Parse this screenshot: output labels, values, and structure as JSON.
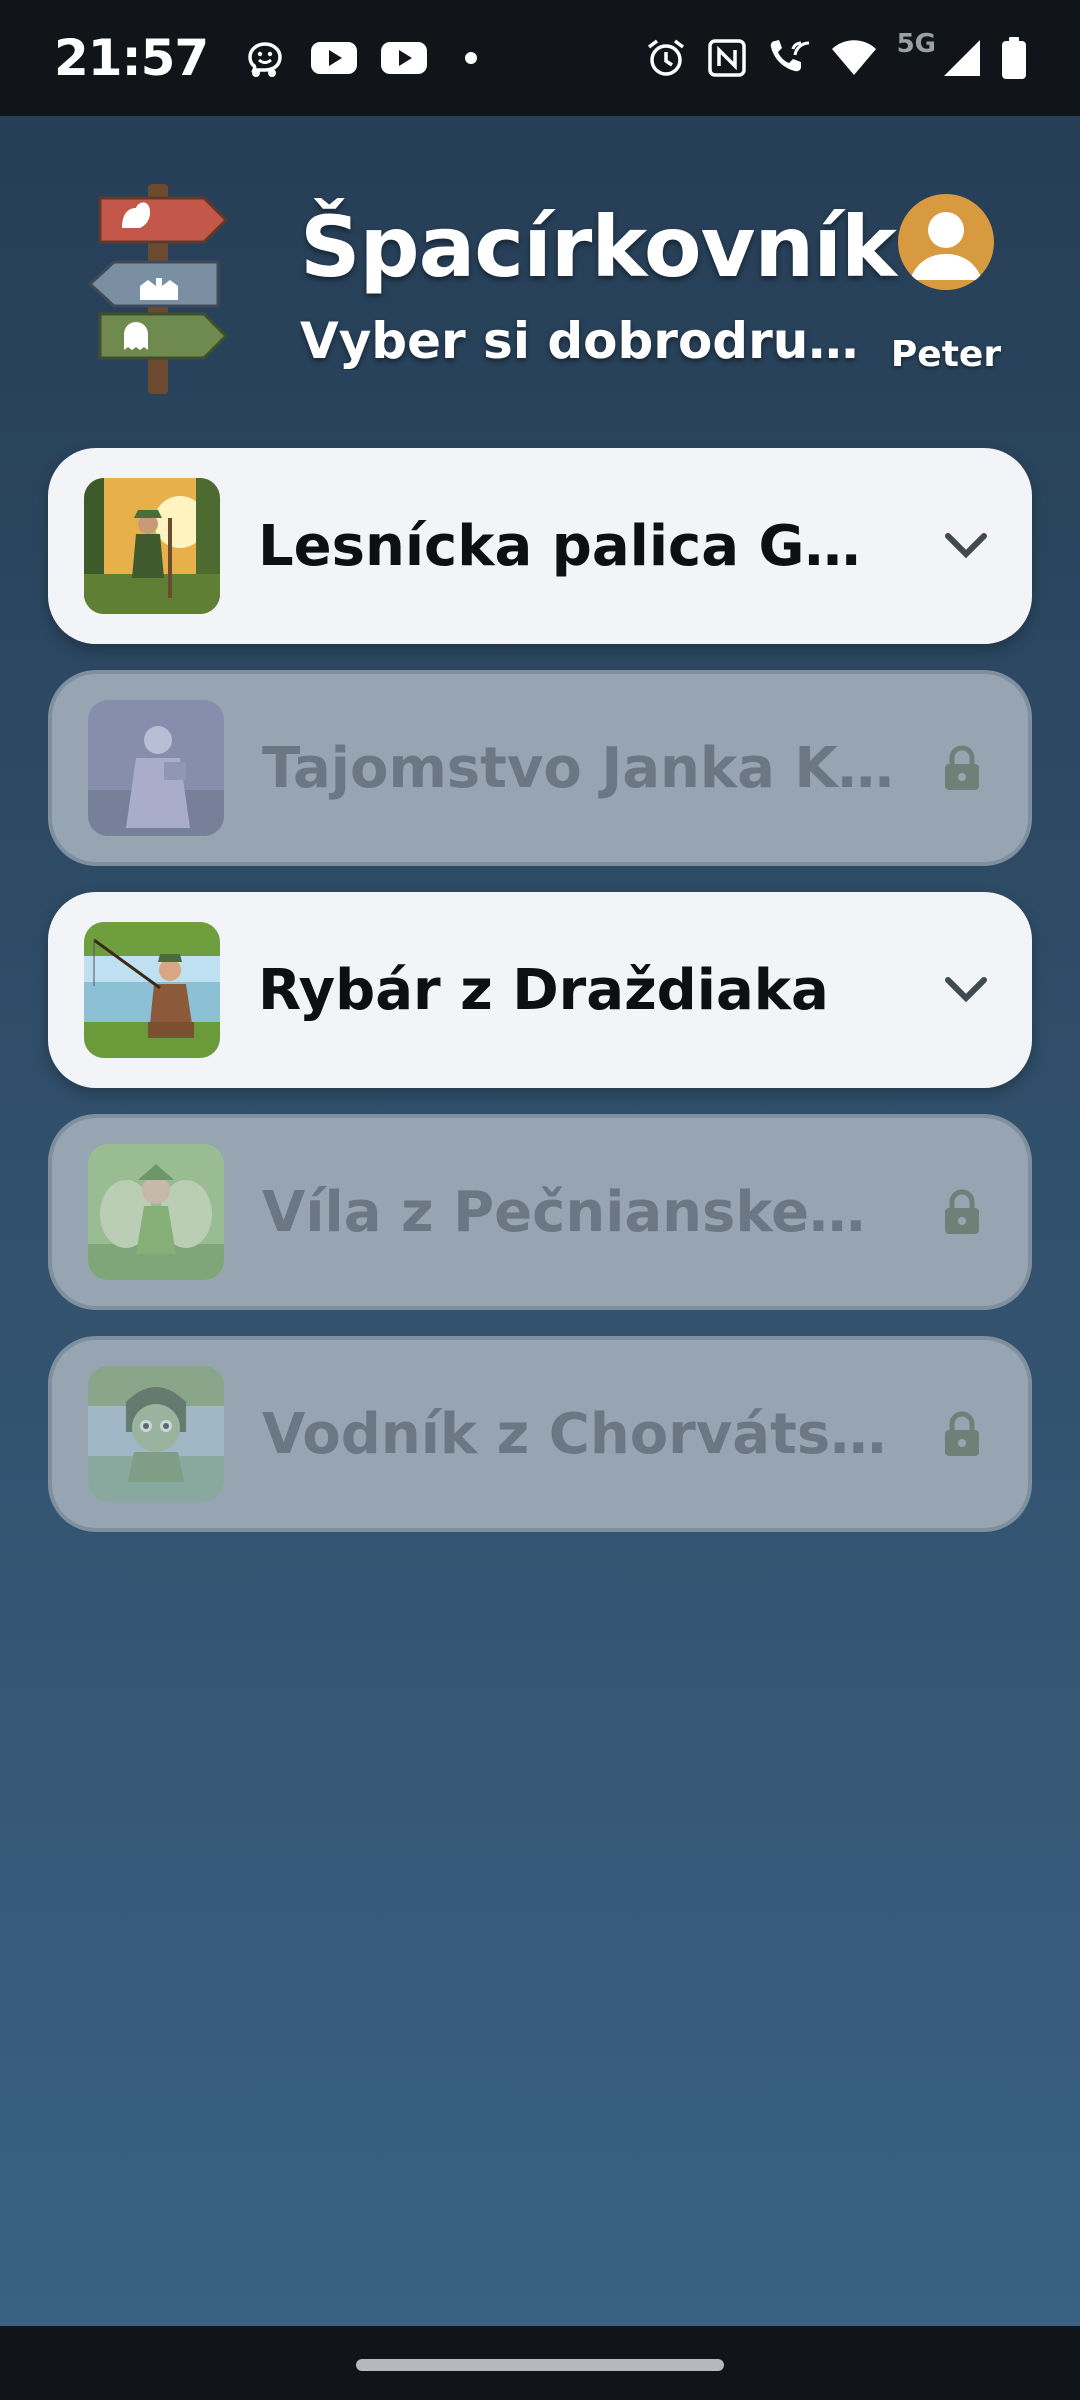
{
  "status_bar": {
    "time": "21:57",
    "network": "5G",
    "icons_left": [
      "waze-icon",
      "youtube-icon",
      "youtube-icon",
      "notification-dot-icon"
    ],
    "icons_right": [
      "alarm-icon",
      "nfc-icon",
      "wifi-calling-icon",
      "wifi-icon",
      "signal-icon",
      "battery-icon"
    ]
  },
  "header": {
    "title": "Špacírkovník",
    "subtitle": "Vyber si dobrodruž...",
    "profile_name": "Peter",
    "logo": "signpost-logo"
  },
  "colors": {
    "background_top": "#263e56",
    "background_bottom": "#3a6182",
    "card_unlocked": "#f2f4f7",
    "card_locked": "#97a5b2",
    "avatar": "#d89a3f"
  },
  "adventures": [
    {
      "title": "Lesnícka palica Gejz...",
      "locked": false,
      "trailing_icon": "chevron-down-icon"
    },
    {
      "title": "Tajomstvo Janka Kráľa",
      "locked": true,
      "trailing_icon": "lock-icon"
    },
    {
      "title": "Rybár z Draždiaka",
      "locked": false,
      "trailing_icon": "chevron-down-icon"
    },
    {
      "title": "Víla z Pečnianskeho l...",
      "locked": true,
      "trailing_icon": "lock-icon"
    },
    {
      "title": "Vodník z Chorvátské...",
      "locked": true,
      "trailing_icon": "lock-icon"
    }
  ]
}
